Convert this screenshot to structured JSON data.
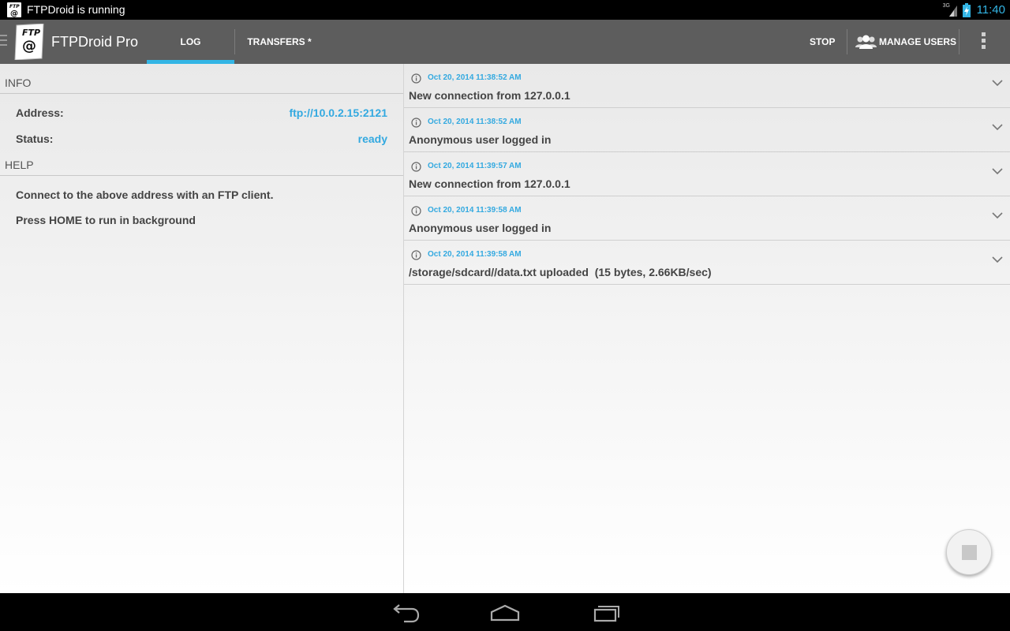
{
  "status_bar": {
    "notification_text": "FTPDroid is running",
    "network_label": "3G",
    "time": "11:40",
    "icons": [
      "ftpdroid-notification-icon",
      "signal-icon",
      "battery-charging-icon"
    ]
  },
  "action_bar": {
    "app_title": "FTPDroid Pro",
    "tabs": [
      {
        "label": "LOG",
        "selected": true
      },
      {
        "label": "TRANSFERS *",
        "selected": false
      }
    ],
    "actions": {
      "stop": "STOP",
      "manage_users": "MANAGE USERS"
    },
    "accent_color": "#33b5e5",
    "background_color": "#5d5d5d"
  },
  "info": {
    "header": "INFO",
    "rows": [
      {
        "label": "Address:",
        "value": "ftp://10.0.2.15:2121"
      },
      {
        "label": "Status:",
        "value": "ready"
      }
    ]
  },
  "help": {
    "header": "HELP",
    "lines": [
      "Connect to the above address with an FTP client.",
      "Press HOME to run in background"
    ]
  },
  "log": {
    "entries": [
      {
        "time": "Oct 20, 2014 11:38:52 AM",
        "message": "New connection from 127.0.0.1"
      },
      {
        "time": "Oct 20, 2014 11:38:52 AM",
        "message": "Anonymous user logged in"
      },
      {
        "time": "Oct 20, 2014 11:39:57 AM",
        "message": "New connection from 127.0.0.1"
      },
      {
        "time": "Oct 20, 2014 11:39:58 AM",
        "message": "Anonymous user logged in"
      },
      {
        "time": "Oct 20, 2014 11:39:58 AM",
        "message": "/storage/sdcard//data.txt uploaded  (15 bytes, 2.66KB/sec)"
      }
    ]
  },
  "fab": {
    "icon": "stop-icon"
  },
  "nav_bar": {
    "icons": [
      "back-icon",
      "home-icon",
      "recents-icon"
    ]
  }
}
